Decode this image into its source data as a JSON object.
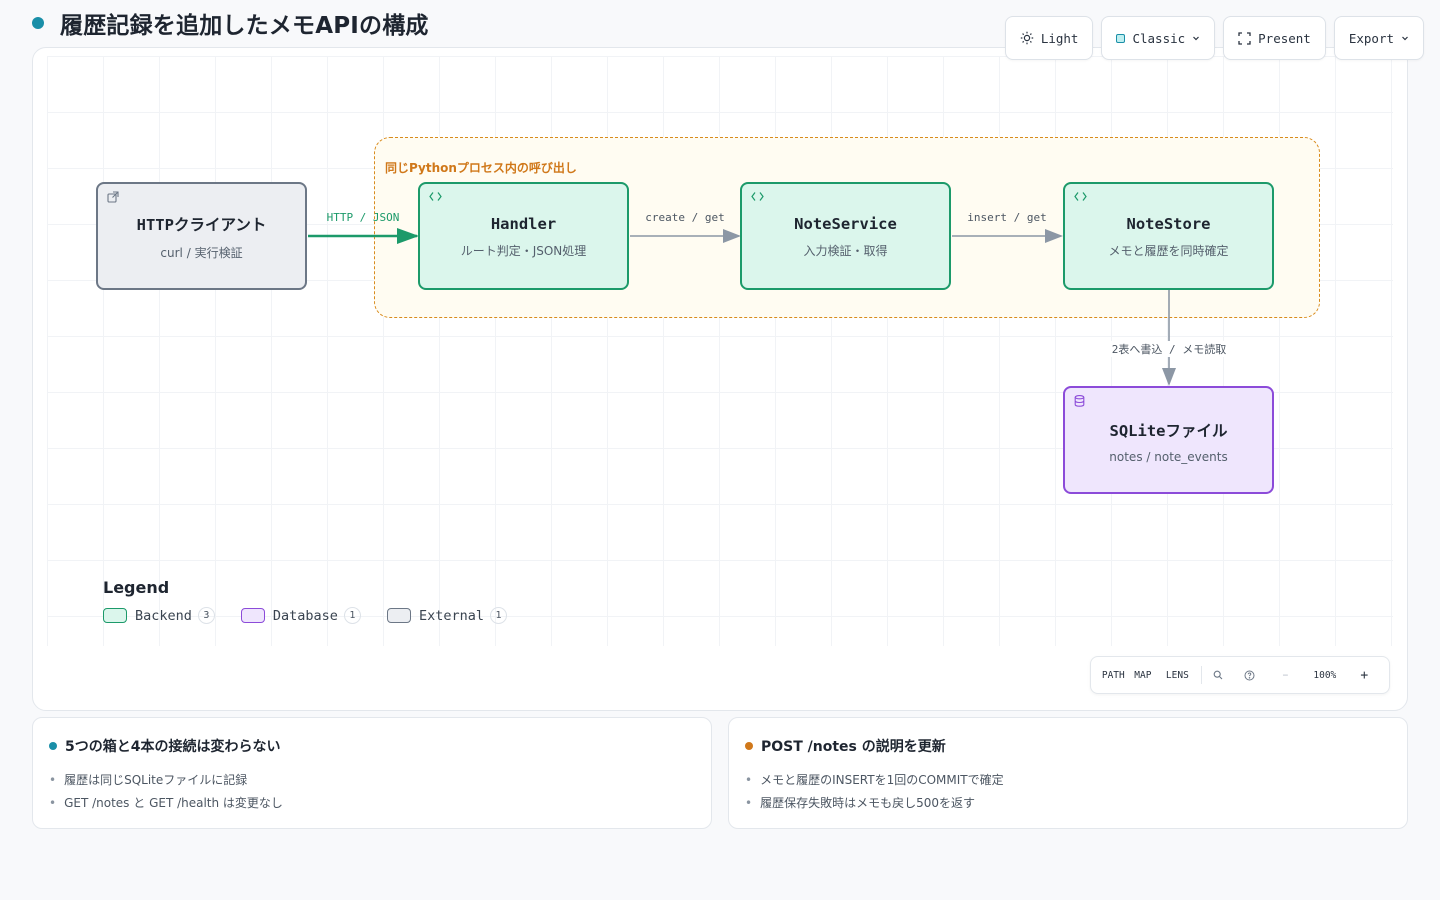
{
  "header": {
    "title": "履歴記録を追加したメモAPIの構成"
  },
  "toolbar": {
    "theme_label": "Light",
    "style_label": "Classic",
    "present_label": "Present",
    "export_label": "Export"
  },
  "diagram": {
    "boundary_label": "同じPythonプロセス内の呼び出し",
    "nodes": {
      "client": {
        "title": "HTTPクライアント",
        "subtitle": "curl / 実行検証",
        "kind": "External"
      },
      "handler": {
        "title": "Handler",
        "subtitle": "ルート判定・JSON処理",
        "kind": "Backend"
      },
      "service": {
        "title": "NoteService",
        "subtitle": "入力検証・取得",
        "kind": "Backend"
      },
      "store": {
        "title": "NoteStore",
        "subtitle": "メモと履歴を同時確定",
        "kind": "Backend"
      },
      "sqlite": {
        "title": "SQLiteファイル",
        "subtitle": "notes / note_events",
        "kind": "Database"
      }
    },
    "edges": {
      "client_handler": "HTTP / JSON",
      "handler_service": "create / get",
      "service_store": "insert / get",
      "store_sqlite": "2表へ書込 / メモ読取"
    },
    "colors": {
      "backend": "#1c9a6a",
      "database": "#8c4bd9",
      "external": "#6c7786",
      "boundary": "#d98b1c"
    }
  },
  "legend": {
    "title": "Legend",
    "items": [
      {
        "label": "Backend",
        "count": "3"
      },
      {
        "label": "Database",
        "count": "1"
      },
      {
        "label": "External",
        "count": "1"
      }
    ]
  },
  "zoombar": {
    "path": "PATH",
    "map": "MAP",
    "lens": "LENS",
    "zoom": "100%",
    "minus": "−",
    "plus": "+"
  },
  "cards": [
    {
      "title": "5つの箱と4本の接続は変わらない",
      "accent": "#1a8fa8",
      "items": [
        "履歴は同じSQLiteファイルに記録",
        "GET /notes と GET /health は変更なし"
      ]
    },
    {
      "title": "POST /notes の説明を更新",
      "accent": "#d0781a",
      "items": [
        "メモと履歴のINSERTを1回のCOMMITで確定",
        "履歴保存失敗時はメモも戻し500を返す"
      ]
    }
  ]
}
